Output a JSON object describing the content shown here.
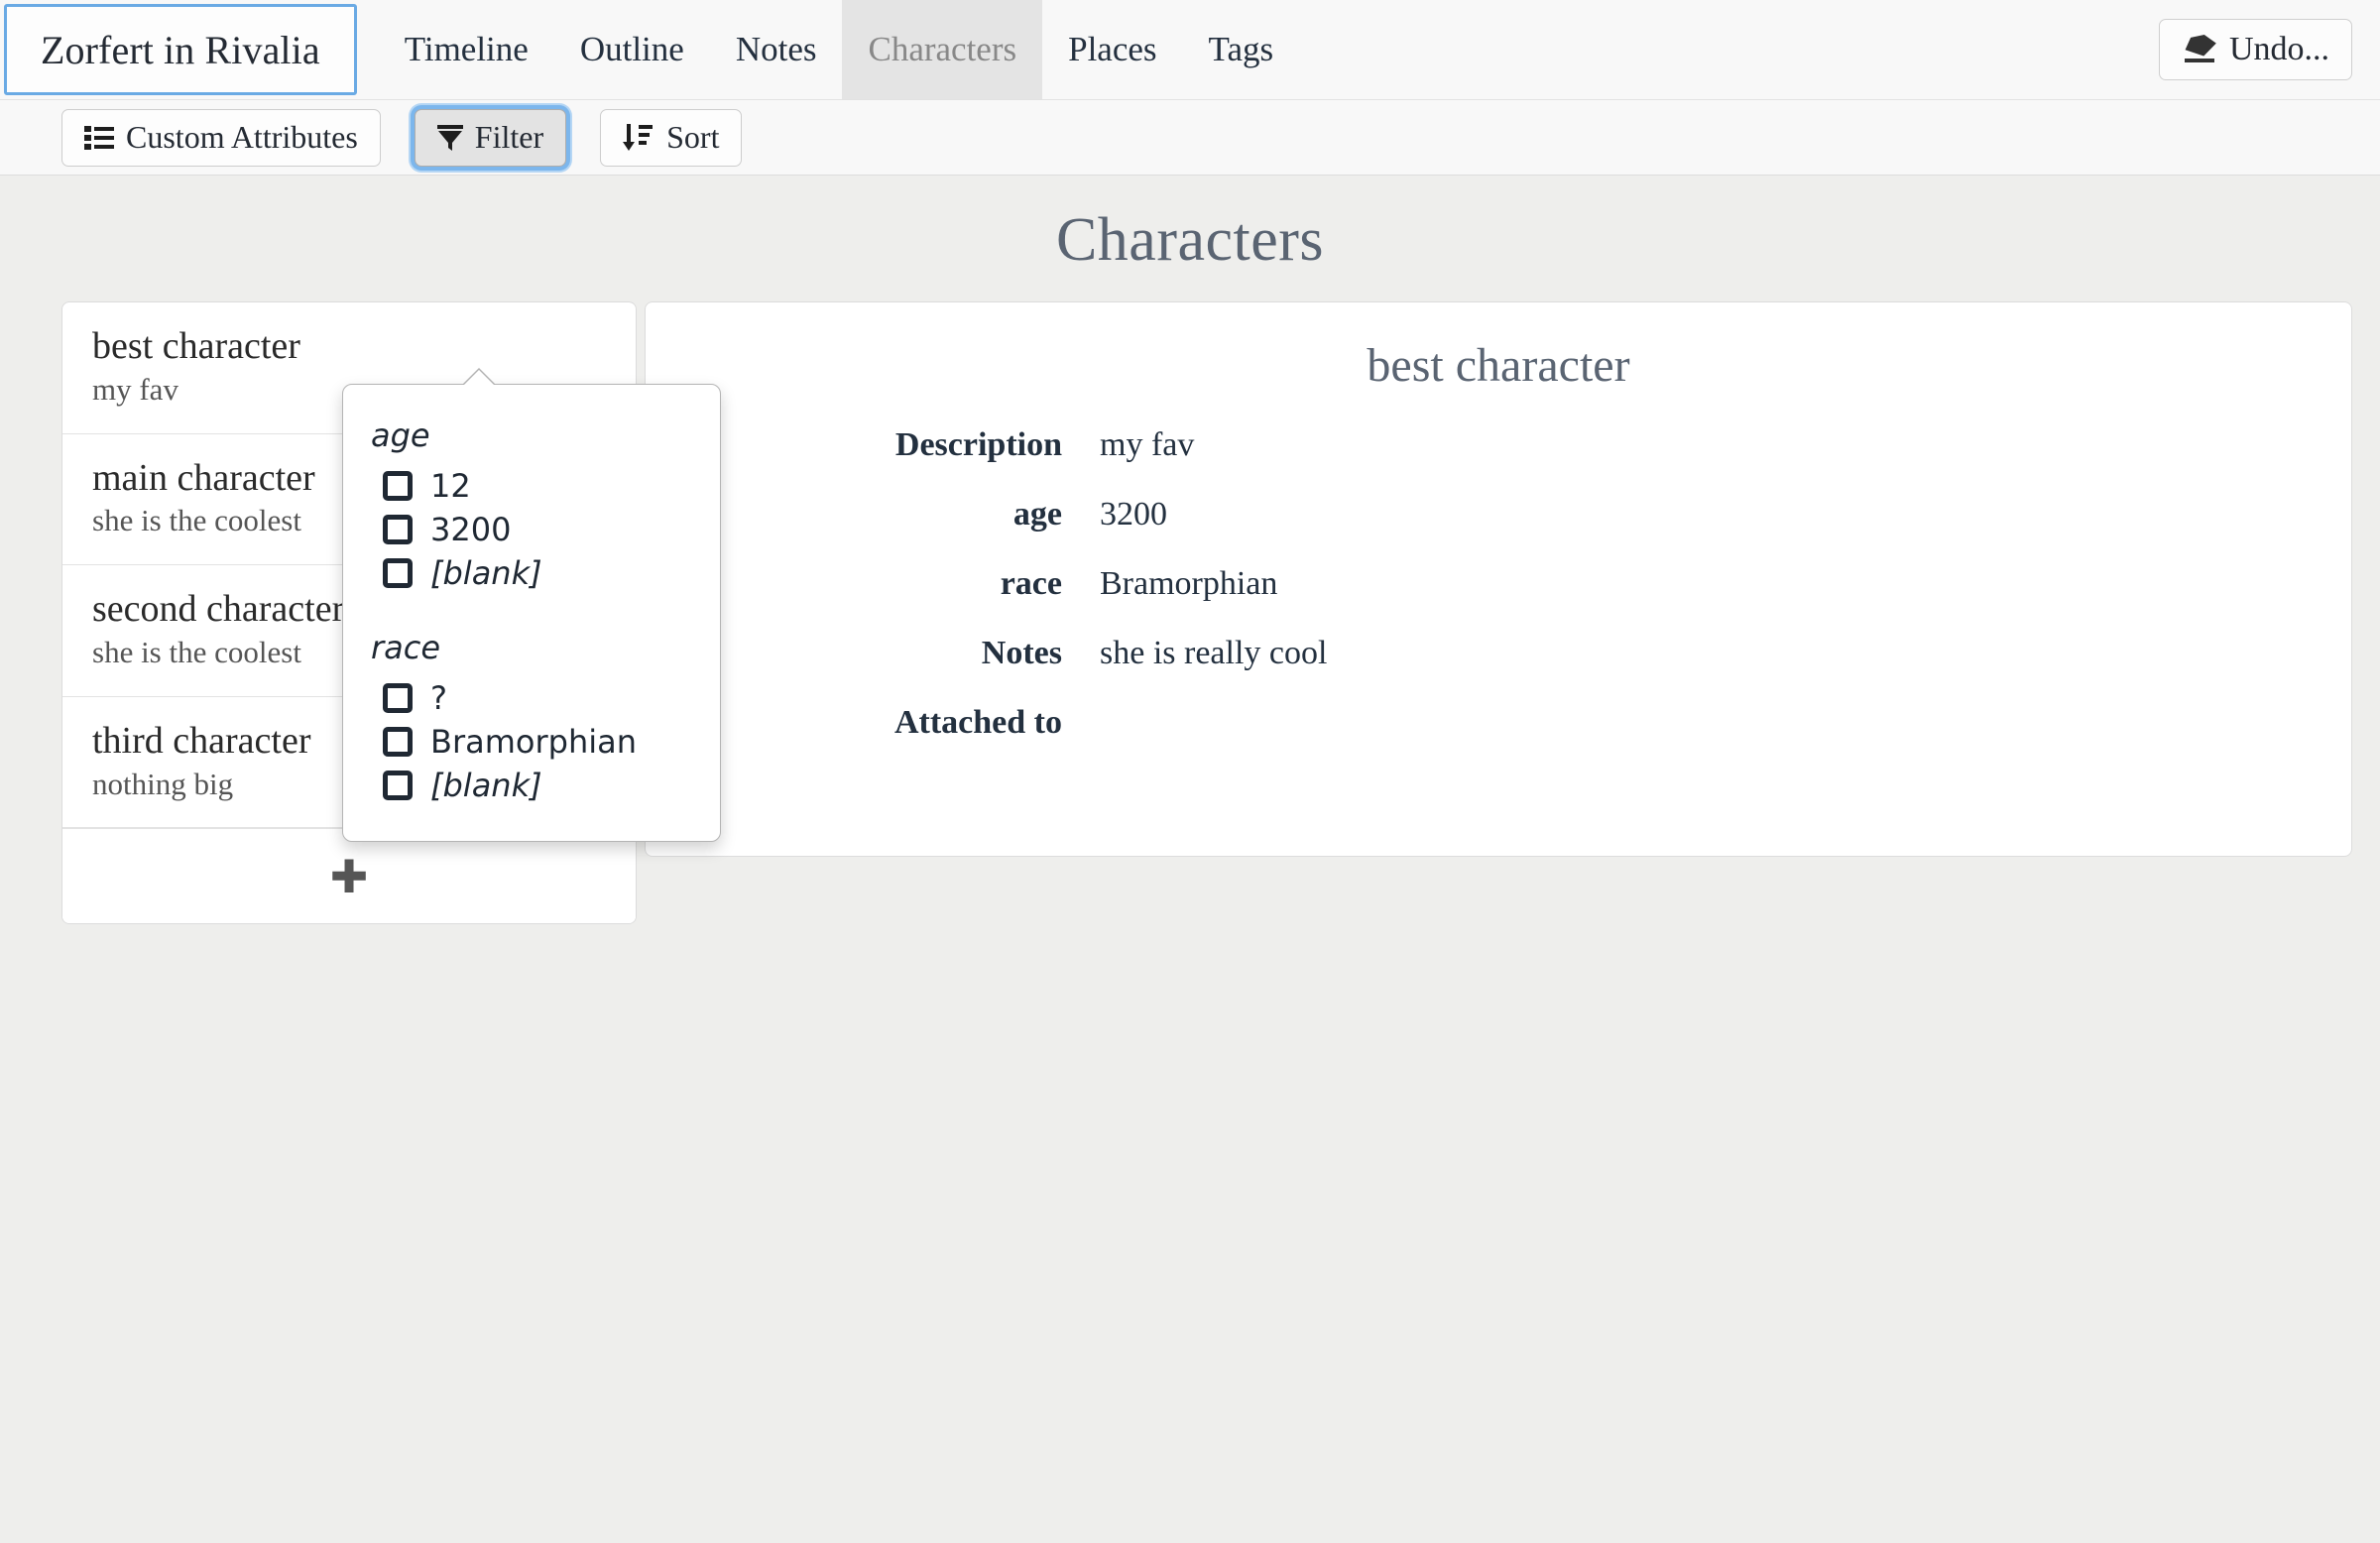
{
  "navbar": {
    "project_title": "Zorfert in Rivalia",
    "tabs": [
      {
        "label": "Timeline",
        "active": false
      },
      {
        "label": "Outline",
        "active": false
      },
      {
        "label": "Notes",
        "active": false
      },
      {
        "label": "Characters",
        "active": true
      },
      {
        "label": "Places",
        "active": false
      },
      {
        "label": "Tags",
        "active": false
      }
    ],
    "undo_label": "Undo...",
    "undo_icon": "eraser-icon"
  },
  "toolbar": {
    "custom_attributes_label": "Custom Attributes",
    "custom_attributes_icon": "list-ul-icon",
    "filter_label": "Filter",
    "filter_icon": "funnel-icon",
    "filter_pressed": true,
    "sort_label": "Sort",
    "sort_icon": "sort-amount-down-icon"
  },
  "filter_popover": {
    "visible": true,
    "groups": [
      {
        "title": "age",
        "options": [
          {
            "label": "12",
            "checked": false,
            "blank": false
          },
          {
            "label": "3200",
            "checked": false,
            "blank": false
          },
          {
            "label": "[blank]",
            "checked": false,
            "blank": true
          }
        ]
      },
      {
        "title": "race",
        "options": [
          {
            "label": "?",
            "checked": false,
            "blank": false
          },
          {
            "label": "Bramorphian",
            "checked": false,
            "blank": false
          },
          {
            "label": "[blank]",
            "checked": false,
            "blank": true
          }
        ]
      }
    ]
  },
  "page": {
    "title": "Characters"
  },
  "character_list": {
    "items": [
      {
        "name": "best character",
        "description": "my fav"
      },
      {
        "name": "main character",
        "description": "she is the coolest"
      },
      {
        "name": "second character",
        "description": "she is the coolest"
      },
      {
        "name": "third character",
        "description": "nothing big"
      }
    ],
    "add_icon": "plus-icon"
  },
  "detail": {
    "title": "best character",
    "fields": [
      {
        "label": "Description",
        "value": "my fav"
      },
      {
        "label": "age",
        "value": "3200"
      },
      {
        "label": "race",
        "value": "Bramorphian"
      },
      {
        "label": "Notes",
        "value": "she is really cool"
      },
      {
        "label": "Attached to",
        "value": ""
      }
    ]
  },
  "colors": {
    "focus_blue": "#6aaae4",
    "page_title_slate": "#5a6472",
    "content_bg": "#eeeeec",
    "navbar_bg": "#f8f8f8",
    "active_tab_bg": "#e4e4e4"
  }
}
